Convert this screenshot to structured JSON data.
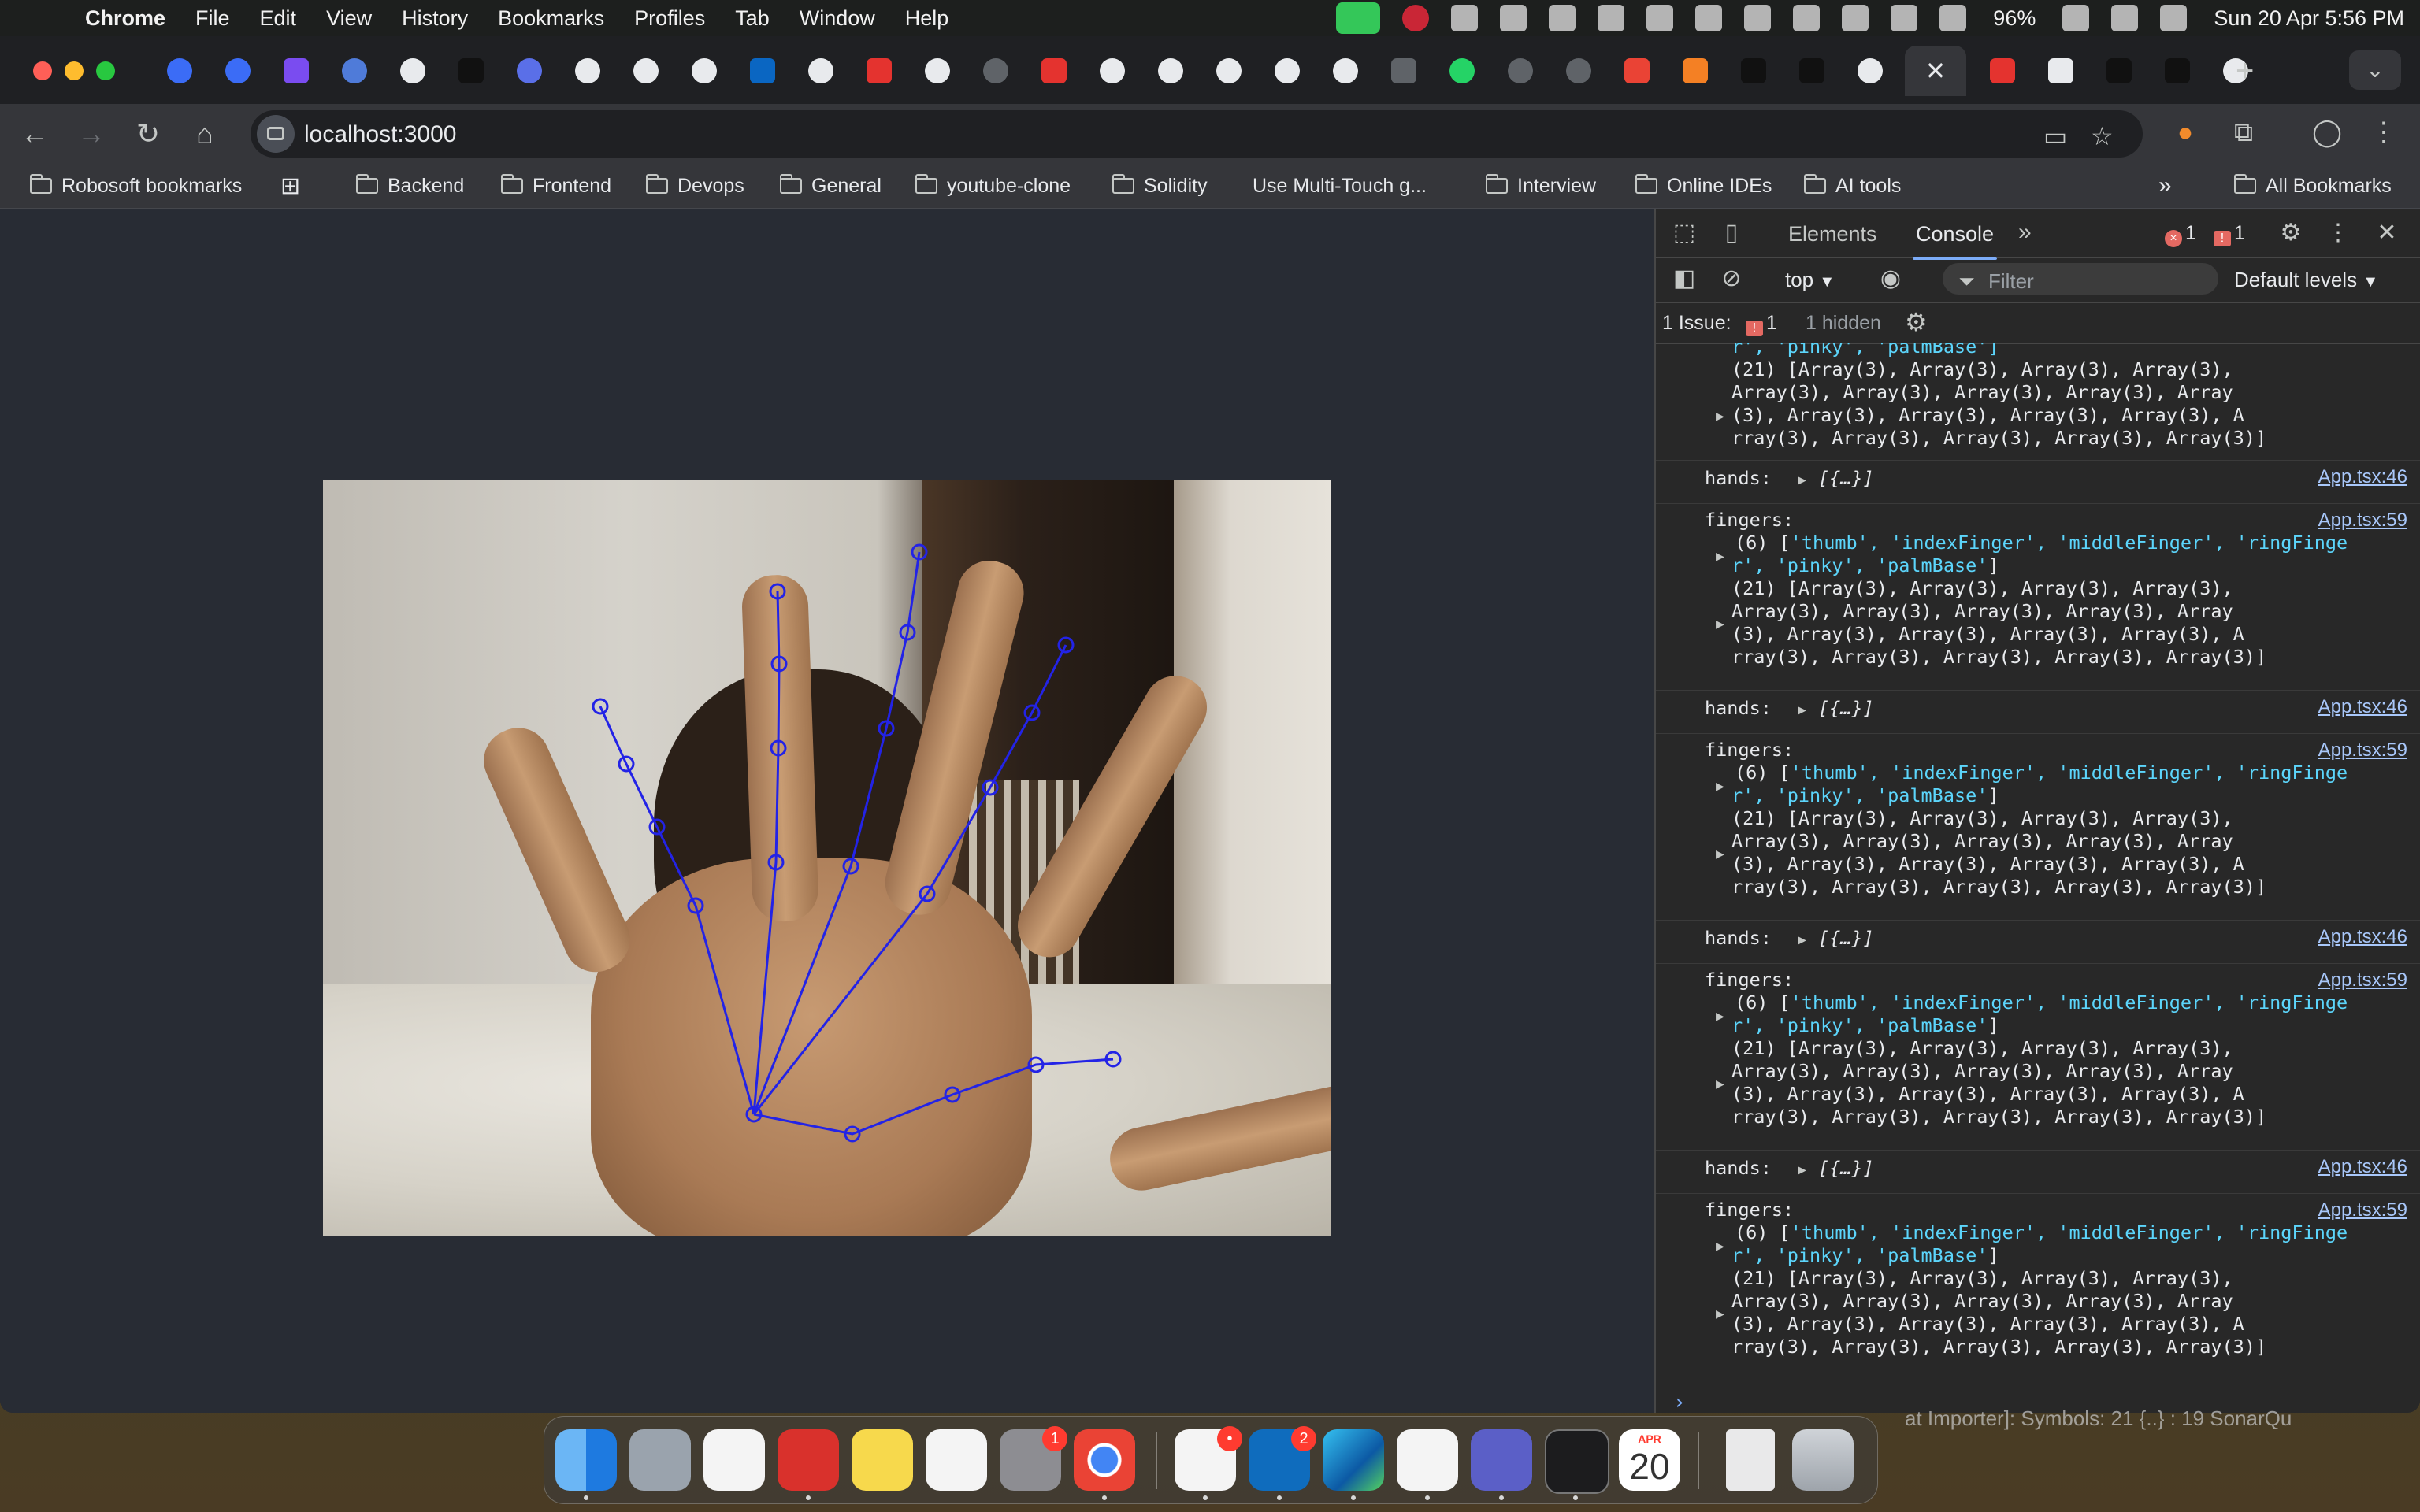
{
  "menubar": {
    "app": "Chrome",
    "items": [
      "File",
      "Edit",
      "View",
      "History",
      "Bookmarks",
      "Profiles",
      "Tab",
      "Window",
      "Help"
    ],
    "battery": "96%",
    "datetime": "Sun 20 Apr  5:56 PM"
  },
  "browser": {
    "url": "localhost:3000",
    "bookmarks": [
      "Robosoft bookmarks",
      "Backend",
      "Frontend",
      "Devops",
      "General",
      "youtube-clone",
      "Solidity",
      "Use Multi-Touch g...",
      "Interview",
      "Online IDEs",
      "AI tools"
    ],
    "all_bookmarks": "All Bookmarks",
    "overflow": "»"
  },
  "devtools": {
    "tabs": [
      "Elements",
      "Console"
    ],
    "more_tabs": "»",
    "error_count": "1",
    "warning_count": "1",
    "context": "top",
    "filter_placeholder": "Filter",
    "levels": "Default levels",
    "issues_label": "1 Issue:",
    "issues_count": "1",
    "hidden_label": "1 hidden"
  },
  "console": {
    "partial_top": [
      "r', 'pinky', 'palmBase']",
      "(21) [Array(3), Array(3), Array(3), Array(3),",
      "Array(3), Array(3), Array(3), Array(3), Array",
      "(3), Array(3), Array(3), Array(3), Array(3), A",
      "rray(3), Array(3), Array(3), Array(3), Array(3)]"
    ],
    "hands_label": "hands:",
    "hands_value": "[{…}]",
    "hands_src": "App.tsx:46",
    "fingers_label": "fingers:",
    "fingers_src": "App.tsx:59",
    "fingers_line1_pre": "(6) [",
    "fingers_line1_str": "'thumb', 'indexFinger', 'middleFinger', 'ringFinge",
    "fingers_line2_str": "r', 'pinky', 'palmBase'",
    "fingers_line2_post": "]",
    "array_lines": [
      "(21) [Array(3), Array(3), Array(3), Array(3),",
      "Array(3), Array(3), Array(3), Array(3), Array",
      "(3), Array(3), Array(3), Array(3), Array(3), A",
      "rray(3), Array(3), Array(3), Array(3), Array(3)]"
    ],
    "prompt": "›"
  },
  "dock": {
    "badges": {
      "settings": "1",
      "slack": "•",
      "outlook": "2"
    },
    "calendar_month": "APR",
    "calendar_day": "20",
    "bg_text": "at Importer]: Symbols: 21    {..} : 19         SonarQu"
  }
}
